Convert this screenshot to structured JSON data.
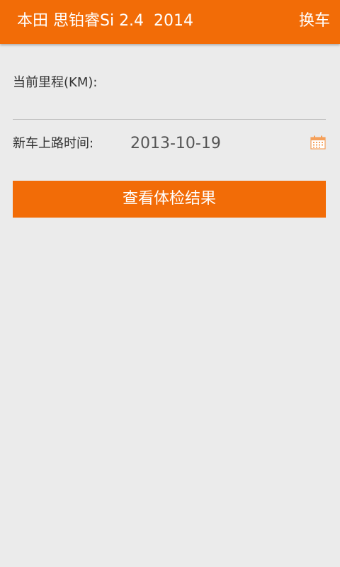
{
  "header": {
    "title": "本田 思铂睿Si 2.4  2014",
    "switch_label": "换车"
  },
  "form": {
    "mileage_label": "当前里程(KM):",
    "mileage_value": "",
    "date_label": "新车上路时间:",
    "date_value": "2013-10-19",
    "calendar_icon": "calendar-icon"
  },
  "actions": {
    "check_label": "查看体检结果"
  },
  "colors": {
    "accent": "#f26c07",
    "background": "#ebebeb"
  }
}
